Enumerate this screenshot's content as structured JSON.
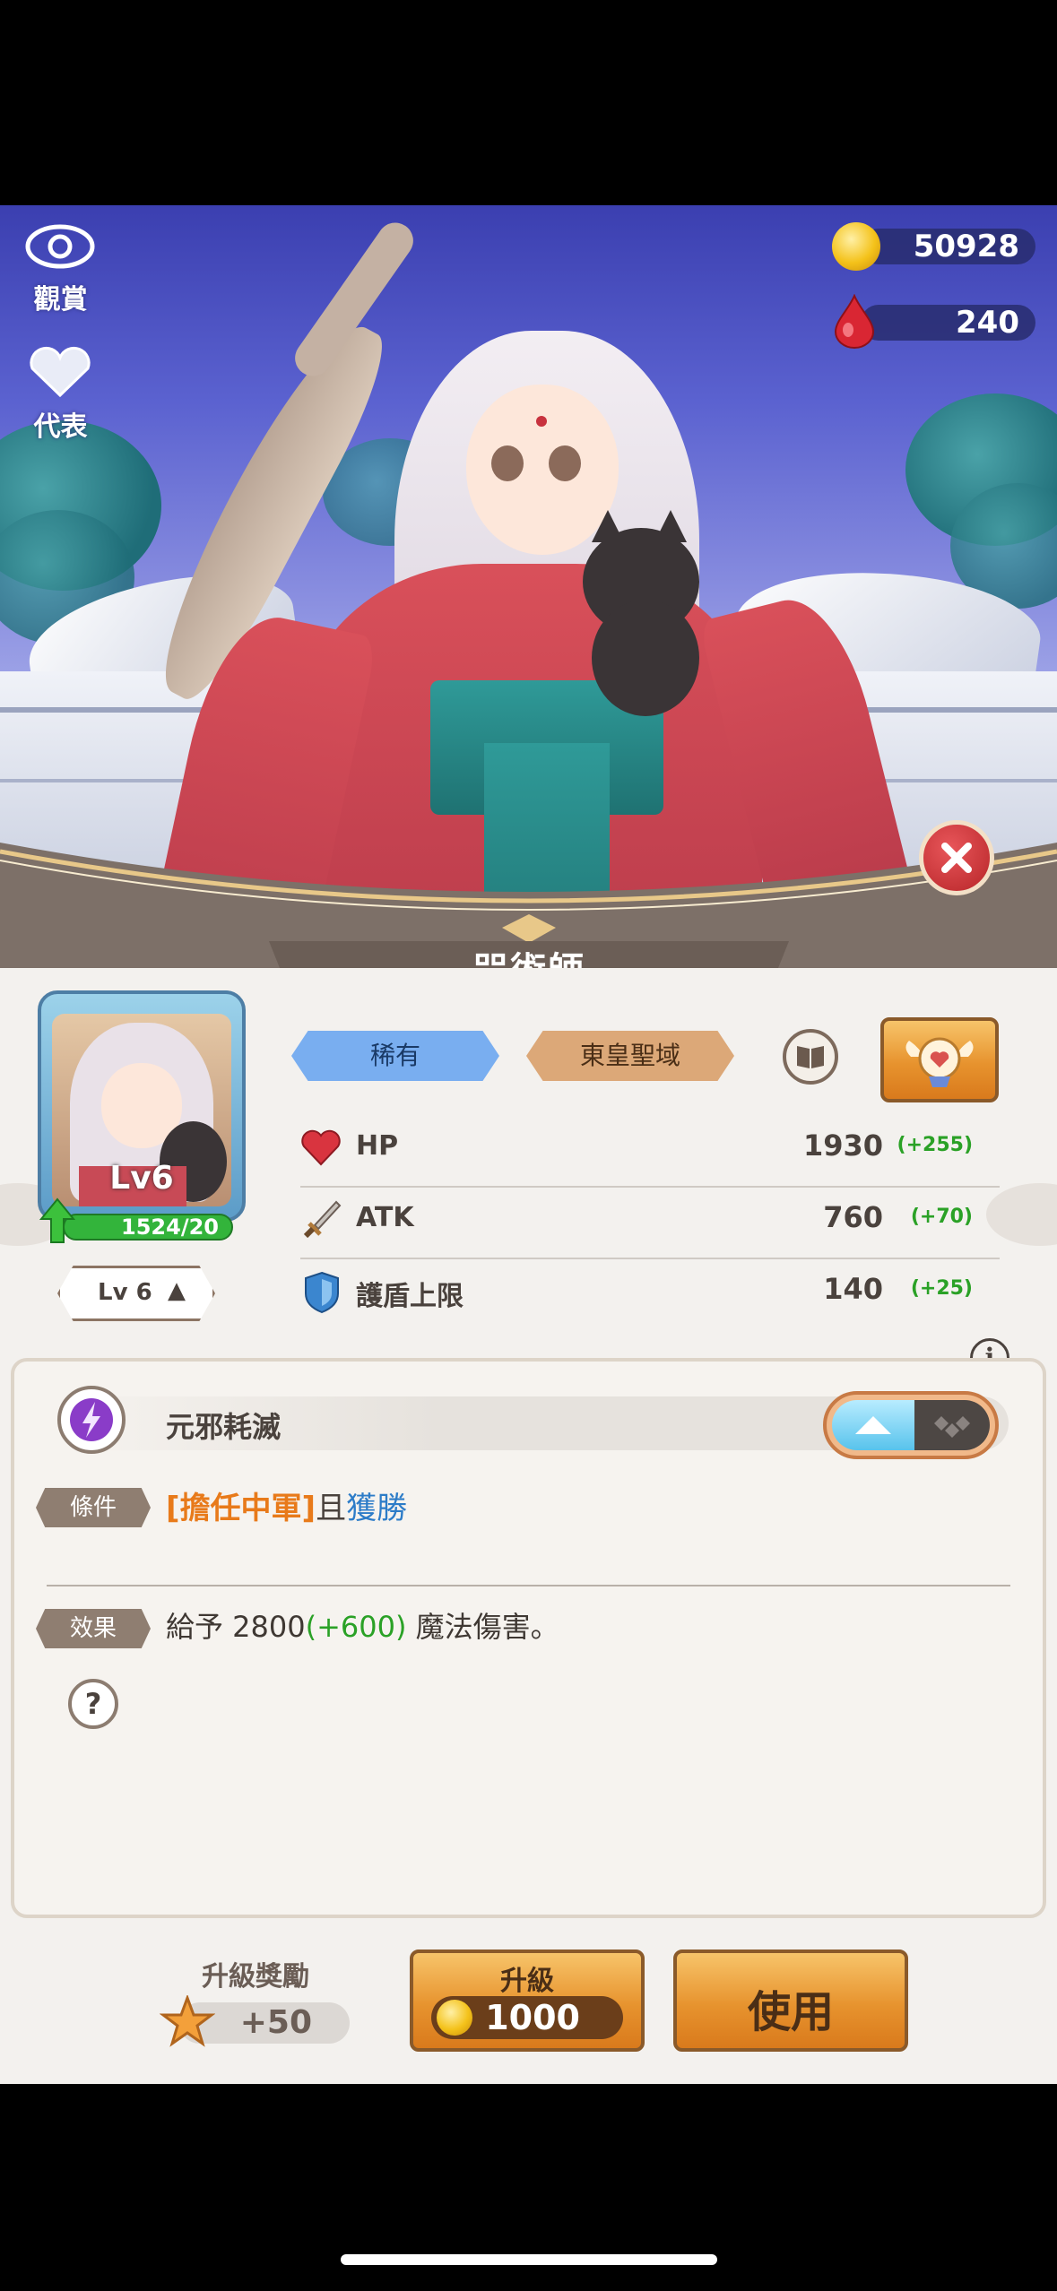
{
  "top_left": {
    "view_label": "觀賞",
    "rep_label": "代表"
  },
  "currency": {
    "gold": "50928",
    "gems": "240"
  },
  "character": {
    "class_name": "咒術師",
    "level_badge": "Lv6",
    "exp_text": "1524/20",
    "level_button": "Lv 6"
  },
  "chips": {
    "rarity": "稀有",
    "region": "東皇聖域"
  },
  "stats": [
    {
      "label": "HP",
      "value": "1930",
      "bonus": "(+255)"
    },
    {
      "label": "ATK",
      "value": "760",
      "bonus": "(+70)"
    },
    {
      "label": "護盾上限",
      "value": "140",
      "bonus": "(+25)"
    }
  ],
  "skill": {
    "name": "元邪耗滅",
    "condition_tag": "條件",
    "condition_highlight": "[擔任中軍]",
    "condition_and": "且",
    "condition_win": "獲勝",
    "effect_tag": "效果",
    "effect_prefix": "給予 2800",
    "effect_bonus": "(+600)",
    "effect_suffix": " 魔法傷害。"
  },
  "footer": {
    "reward_label": "升級獎勵",
    "reward_value": "+50",
    "upgrade_label": "升級",
    "upgrade_cost": "1000",
    "use_label": "使用"
  },
  "colors": {
    "rarity_blue": "#79aef0",
    "region_tan": "#dca878",
    "bonus_green": "#2aa126",
    "condition_orange": "#e87a1a",
    "link_blue": "#2d7cc8"
  }
}
